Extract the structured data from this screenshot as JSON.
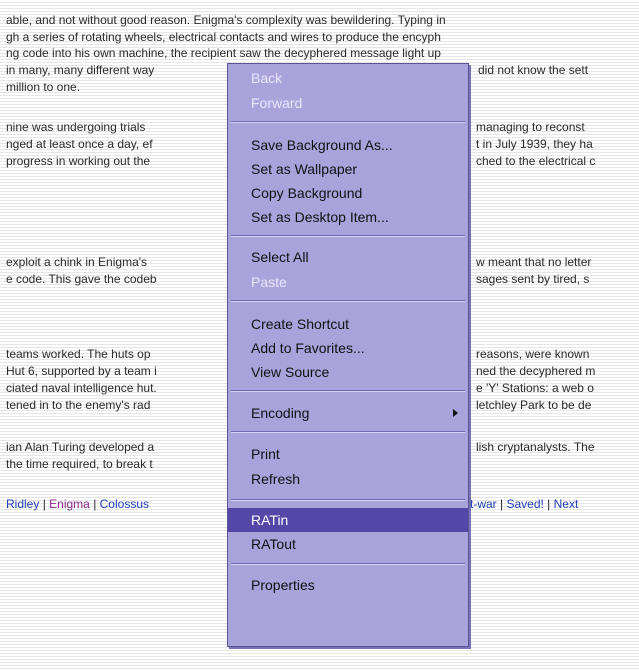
{
  "paragraphs": {
    "p1": [
      "able, and not without good reason. Enigma's complexity was bewildering. Typing in",
      "gh a series of rotating wheels, electrical contacts and wires to produce the encyph",
      "ng code into his own machine, the recipient saw the decyphered message light up",
      "in many, many different way",
      "million to one."
    ],
    "p1_right": [
      "did not know the sett"
    ],
    "p2_left": [
      "nine was undergoing trials",
      "nged at least once a day, ef",
      "progress in working out the"
    ],
    "p2_right": [
      "managing to reconst",
      "t in July 1939, they ha",
      "ched to the electrical c"
    ],
    "p3_left": [
      "exploit a chink in Enigma's",
      "e code. This gave the codeb"
    ],
    "p3_right": [
      "w meant that no letter",
      "sages sent by tired, s"
    ],
    "p4_left": [
      "teams worked. The huts op",
      "Hut 6, supported by a team i",
      "ciated naval intelligence hut.",
      "tened in to the enemy's rad"
    ],
    "p4_right": [
      "reasons, were known",
      "ned the decyphered m",
      "e 'Y' Stations: a web o",
      "letchley Park to be de"
    ],
    "p5_left": [
      "ian Alan Turing developed a",
      "the time required, to break t"
    ],
    "p5_right": [
      "lish cryptanalysts. The"
    ]
  },
  "nav": {
    "left": [
      "Ridley",
      "Enigma",
      "Colossus"
    ],
    "right": [
      "st-war",
      "Saved!",
      "Next"
    ]
  },
  "context_menu": {
    "items": [
      {
        "label": "Back",
        "disabled": true
      },
      {
        "label": "Forward",
        "disabled": true
      },
      {
        "label": "Save Background As..."
      },
      {
        "label": "Set as Wallpaper"
      },
      {
        "label": "Copy Background"
      },
      {
        "label": "Set as Desktop Item..."
      },
      {
        "label": "Select All"
      },
      {
        "label": "Paste",
        "disabled": true
      },
      {
        "label": "Create Shortcut"
      },
      {
        "label": "Add to Favorites..."
      },
      {
        "label": "View Source"
      },
      {
        "label": "Encoding",
        "submenu": true
      },
      {
        "label": "Print"
      },
      {
        "label": "Refresh"
      },
      {
        "label": "RATin",
        "selected": true
      },
      {
        "label": "RATout"
      },
      {
        "label": "Properties"
      }
    ]
  },
  "colors": {
    "menu_bg": "#a9a3dc",
    "menu_selected": "#5547a8",
    "link": "#1f3fb8",
    "visited_link": "#8a2a8a"
  }
}
